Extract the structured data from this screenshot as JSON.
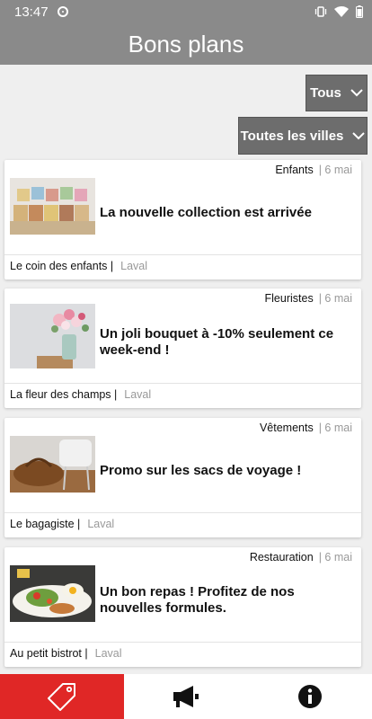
{
  "status": {
    "time": "13:47"
  },
  "header": {
    "title": "Bons plans"
  },
  "filters": {
    "category": "Tous",
    "city": "Toutes les villes"
  },
  "cards": [
    {
      "category": "Enfants",
      "date": "| 6 mai",
      "title": "La nouvelle collection est arrivée",
      "shop": "Le coin des enfants |",
      "city": "Laval"
    },
    {
      "category": "Fleuristes",
      "date": "| 6 mai",
      "title": "Un joli bouquet à -10% seulement ce week-end !",
      "shop": "La fleur des champs |",
      "city": "Laval"
    },
    {
      "category": "Vêtements",
      "date": "| 6 mai",
      "title": "Promo sur les sacs de voyage !",
      "shop": "Le bagagiste |",
      "city": "Laval"
    },
    {
      "category": "Restauration",
      "date": "| 6 mai",
      "title": "Un bon repas ! Profitez de nos nouvelles formules.",
      "shop": "Au petit bistrot |",
      "city": "Laval"
    }
  ],
  "colors": {
    "appbar": "#8a8a8a",
    "filter_bg": "#6d6d6d",
    "active_tab": "#e02726"
  },
  "icons": {
    "nav": [
      "tag-icon",
      "megaphone-icon",
      "info-icon"
    ]
  }
}
